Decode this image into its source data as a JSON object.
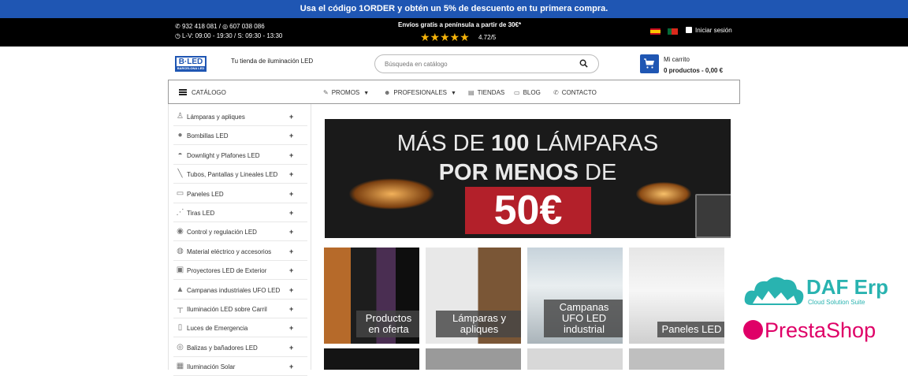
{
  "promo_bar": {
    "text": "Usa el código 1ORDER y obtén un 5% de descuento en tu primera compra."
  },
  "top_bar": {
    "phones": "932 418 081 / ",
    "whatsapp": "607 038 086",
    "hours": "L-V: 09:00 - 19:30 / S: 09:30 - 13:30",
    "shipping": "Envíos gratis a península a partir de 30€*",
    "stars": "★★★★★",
    "rating": "4.72/5",
    "login": "Iniciar sesión"
  },
  "header": {
    "logo_text": "B·LED",
    "logo_sub": "BARCELONA LED",
    "tagline": "Tu tienda de iluminación LED",
    "search_placeholder": "Búsqueda en catálogo",
    "cart_title": "Mi carrito",
    "cart_total": "0 productos - 0,00 €"
  },
  "nav": {
    "catalog": "CATÁLOGO",
    "promos": "PROMOS",
    "pros": "PROFESIONALES",
    "stores": "TIENDAS",
    "blog": "BLOG",
    "contact": "CONTACTO"
  },
  "sidebar": {
    "items": [
      {
        "label": "Lámparas y apliques",
        "icon": "lamp-icon"
      },
      {
        "label": "Bombillas LED",
        "icon": "bulb-icon"
      },
      {
        "label": "Downlight y Plafones LED",
        "icon": "downlight-icon"
      },
      {
        "label": "Tubos, Pantallas y Lineales LED",
        "icon": "tube-icon"
      },
      {
        "label": "Paneles LED",
        "icon": "panel-icon"
      },
      {
        "label": "Tiras LED",
        "icon": "strip-icon"
      },
      {
        "label": "Control y regulación LED",
        "icon": "control-icon"
      },
      {
        "label": "Material eléctrico y accesorios",
        "icon": "plug-icon"
      },
      {
        "label": "Proyectores LED de Exterior",
        "icon": "floodlight-icon"
      },
      {
        "label": "Campanas industriales UFO LED",
        "icon": "ufo-icon"
      },
      {
        "label": "Iluminación LED sobre Carril",
        "icon": "track-icon"
      },
      {
        "label": "Luces de Emergencia",
        "icon": "emergency-icon"
      },
      {
        "label": "Balizas y bañadores LED",
        "icon": "bollard-icon"
      },
      {
        "label": "Iluminación Solar",
        "icon": "solar-icon"
      }
    ],
    "expand_symbol": "+"
  },
  "banner": {
    "line1_prefix": "MÁS DE ",
    "line1_bold": "100",
    "line1_suffix": " LÁMPARAS",
    "line2_bold": "POR MENOS",
    "line2_suffix": " DE",
    "price": "50€"
  },
  "tiles": [
    {
      "label": "Productos en oferta"
    },
    {
      "label": "Lámparas y apliques"
    },
    {
      "label": "Campanas UFO LED industrial"
    },
    {
      "label": "Paneles LED"
    }
  ],
  "brands": {
    "daf_title": "DAF Erp",
    "daf_sub": "Cloud Solution Suite",
    "prestashop": "PrestaShop"
  },
  "colors": {
    "primary": "#1f56b3",
    "accent_red": "#b3202a",
    "star": "#f5b30a",
    "daf": "#29b3b0",
    "prestashop": "#df0067"
  }
}
